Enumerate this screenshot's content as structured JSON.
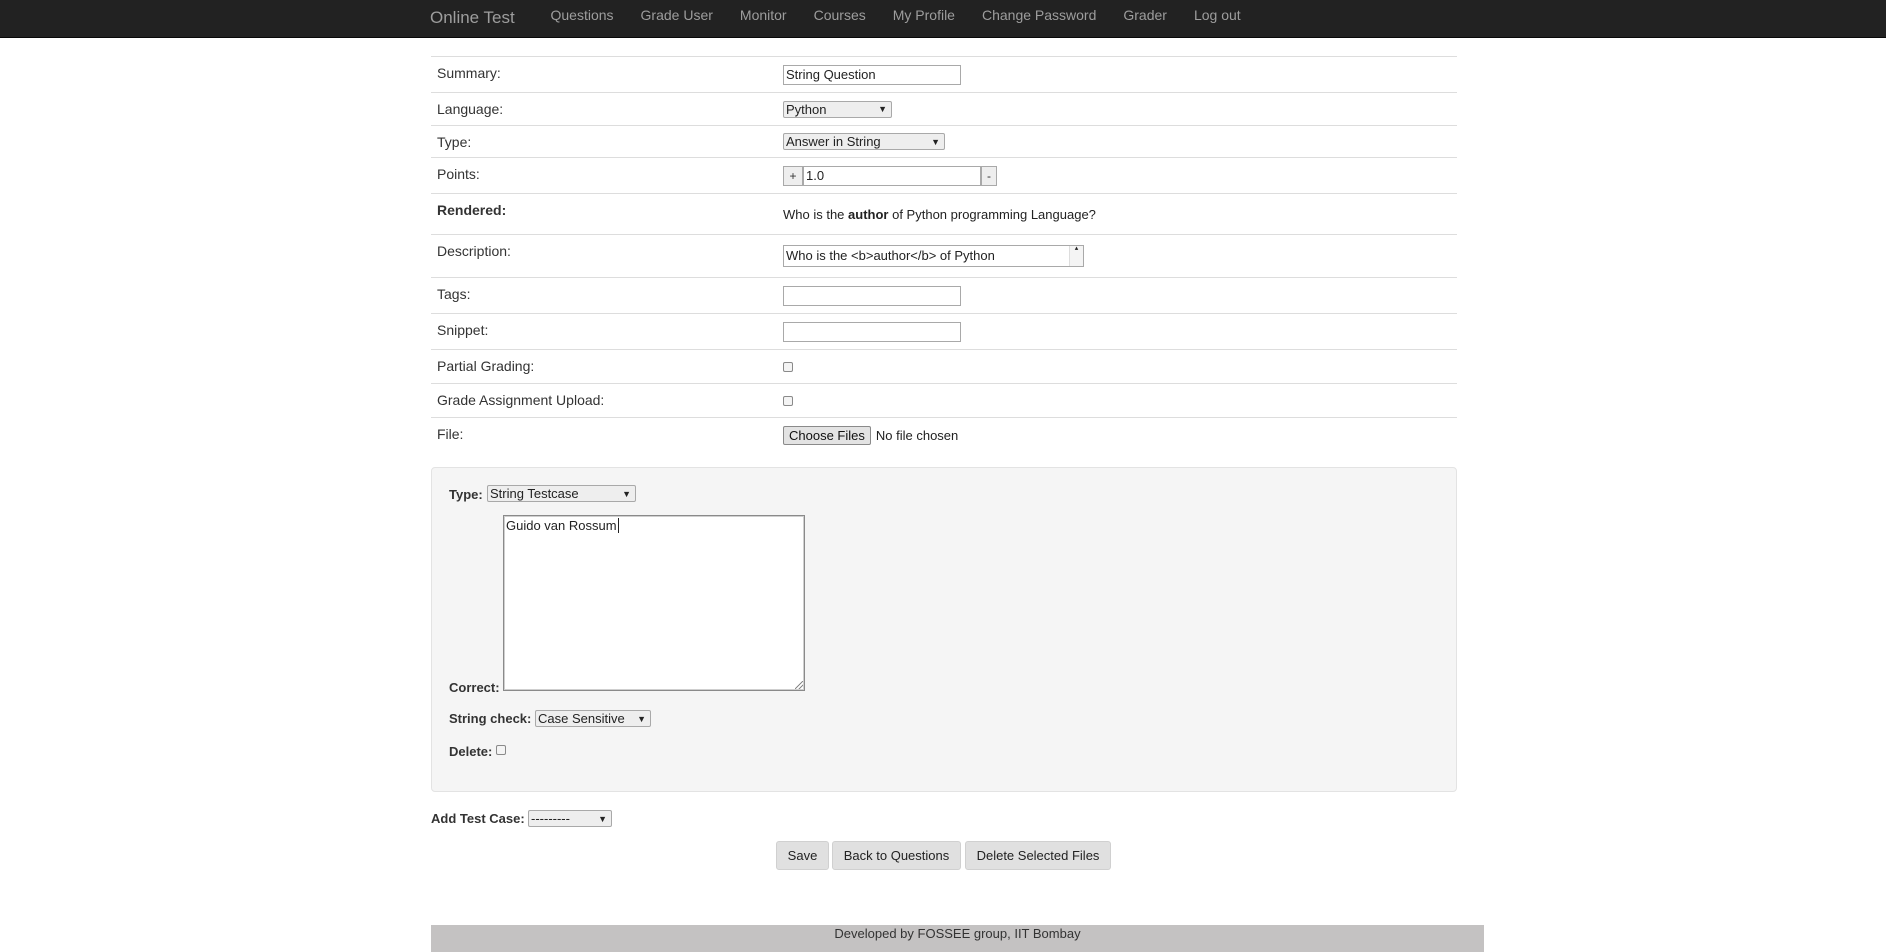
{
  "navbar": {
    "brand": "Online Test",
    "links": [
      "Questions",
      "Grade User",
      "Monitor",
      "Courses",
      "My Profile",
      "Change Password",
      "Grader",
      "Log out"
    ]
  },
  "form": {
    "summary": {
      "label": "Summary:",
      "value": "String Question"
    },
    "language": {
      "label": "Language:",
      "value": "Python"
    },
    "type": {
      "label": "Type:",
      "value": "Answer in String"
    },
    "points": {
      "label": "Points:",
      "plus": "+",
      "value": "1.0",
      "minus": "-"
    },
    "rendered": {
      "label": "Rendered:",
      "before": "Who is the ",
      "bold": "author",
      "after": " of Python programming Language?"
    },
    "description": {
      "label": "Description:",
      "value": "Who is the <b>author</b> of Python"
    },
    "tags": {
      "label": "Tags:",
      "value": ""
    },
    "snippet": {
      "label": "Snippet:",
      "value": ""
    },
    "partial_grading": {
      "label": "Partial Grading:",
      "checked": false
    },
    "grade_assignment_upload": {
      "label": "Grade Assignment Upload:",
      "checked": false
    },
    "file": {
      "label": "File:",
      "button": "Choose Files",
      "status": "No file chosen"
    }
  },
  "testcase": {
    "type_label": "Type:",
    "type_value": "String Testcase",
    "correct_label": "Correct:",
    "correct_value": "Guido van Rossum",
    "string_check_label": "String check:",
    "string_check_value": "Case Sensitive",
    "delete_label": "Delete:"
  },
  "add_test_case": {
    "label": "Add Test Case:",
    "value": "---------"
  },
  "buttons": {
    "save": "Save",
    "back": "Back to Questions",
    "delete_files": "Delete Selected Files"
  },
  "footer": "Developed by FOSSEE group, IIT Bombay"
}
